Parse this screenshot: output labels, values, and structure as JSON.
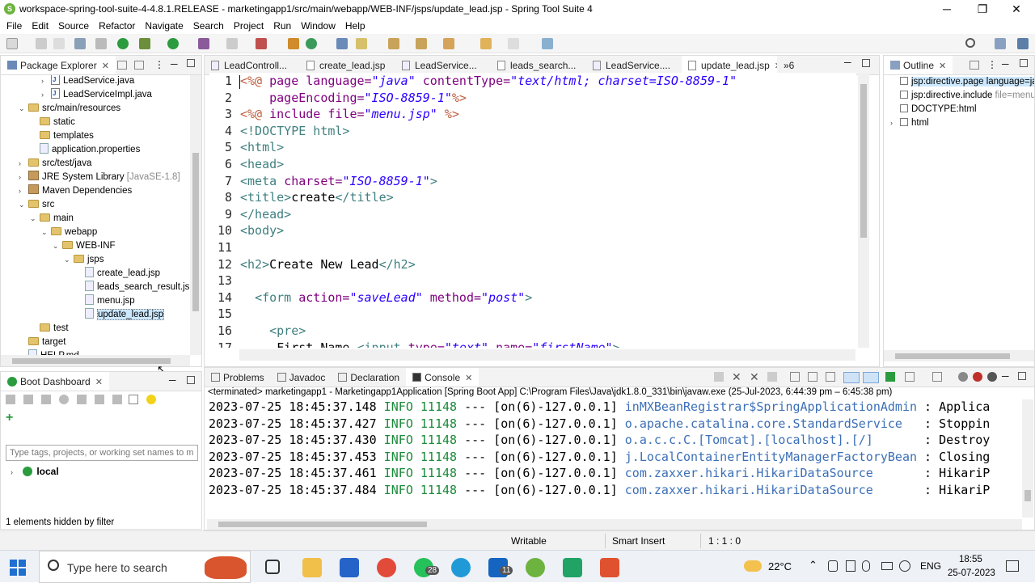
{
  "window": {
    "title": "workspace-spring-tool-suite-4-4.8.1.RELEASE - marketingapp1/src/main/webapp/WEB-INF/jsps/update_lead.jsp - Spring Tool Suite 4",
    "minimize": "─",
    "restore": "❐",
    "close": "✕"
  },
  "menu": [
    "File",
    "Edit",
    "Source",
    "Refactor",
    "Navigate",
    "Search",
    "Project",
    "Run",
    "Window",
    "Help"
  ],
  "package_explorer": {
    "tab_label": "Package Explorer",
    "items": [
      {
        "label": "LeadService.java",
        "extra": "",
        "kind": "java",
        "depth": 4,
        "twisty": "›"
      },
      {
        "label": "LeadServiceImpl.java",
        "extra": "",
        "kind": "java",
        "depth": 4,
        "twisty": "›"
      },
      {
        "label": "src/main/resources",
        "extra": "",
        "kind": "folder",
        "depth": 2,
        "twisty": "⌄"
      },
      {
        "label": "static",
        "extra": "",
        "kind": "folder",
        "depth": 3,
        "twisty": ""
      },
      {
        "label": "templates",
        "extra": "",
        "kind": "folder",
        "depth": 3,
        "twisty": ""
      },
      {
        "label": "application.properties",
        "extra": "",
        "kind": "props",
        "depth": 3,
        "twisty": ""
      },
      {
        "label": "src/test/java",
        "extra": "",
        "kind": "folder",
        "depth": 2,
        "twisty": "›"
      },
      {
        "label": "JRE System Library",
        "extra": " [JavaSE-1.8]",
        "kind": "jar",
        "depth": 2,
        "twisty": "›"
      },
      {
        "label": "Maven Dependencies",
        "extra": "",
        "kind": "jar",
        "depth": 2,
        "twisty": "›"
      },
      {
        "label": "src",
        "extra": "",
        "kind": "folder",
        "depth": 2,
        "twisty": "⌄"
      },
      {
        "label": "main",
        "extra": "",
        "kind": "folder",
        "depth": 3,
        "twisty": "⌄"
      },
      {
        "label": "webapp",
        "extra": "",
        "kind": "folder",
        "depth": 4,
        "twisty": "⌄"
      },
      {
        "label": "WEB-INF",
        "extra": "",
        "kind": "folder",
        "depth": 5,
        "twisty": "⌄"
      },
      {
        "label": "jsps",
        "extra": "",
        "kind": "folder",
        "depth": 6,
        "twisty": "⌄"
      },
      {
        "label": "create_lead.jsp",
        "extra": "",
        "kind": "file",
        "depth": 7,
        "twisty": ""
      },
      {
        "label": "leads_search_result.js",
        "extra": "",
        "kind": "file",
        "depth": 7,
        "twisty": ""
      },
      {
        "label": "menu.jsp",
        "extra": "",
        "kind": "file",
        "depth": 7,
        "twisty": ""
      },
      {
        "label": "update_lead.jsp",
        "extra": "",
        "kind": "file",
        "depth": 7,
        "twisty": "",
        "selected": true
      },
      {
        "label": "test",
        "extra": "",
        "kind": "folder",
        "depth": 3,
        "twisty": ""
      },
      {
        "label": "target",
        "extra": "",
        "kind": "folder",
        "depth": 2,
        "twisty": ""
      },
      {
        "label": "HELP.md",
        "extra": "",
        "kind": "file",
        "depth": 2,
        "twisty": ""
      }
    ]
  },
  "editor": {
    "tabs": [
      {
        "label": "LeadControll...",
        "active": false
      },
      {
        "label": "create_lead.jsp",
        "active": false
      },
      {
        "label": "LeadService...",
        "active": false
      },
      {
        "label": "leads_search...",
        "active": false
      },
      {
        "label": "LeadService....",
        "active": false
      },
      {
        "label": "update_lead.jsp",
        "active": true
      }
    ],
    "overflow": "»6",
    "lines": [
      {
        "n": "1",
        "parts": [
          [
            "jsp",
            "<%@ "
          ],
          [
            "attr",
            "page language="
          ],
          [
            "val",
            "\"java\""
          ],
          [
            "attr",
            " contentType="
          ],
          [
            "val",
            "\"text/html; charset=ISO-8859-1\""
          ]
        ]
      },
      {
        "n": "2",
        "parts": [
          [
            "txt",
            "    "
          ],
          [
            "attr",
            "pageEncoding="
          ],
          [
            "val",
            "\"ISO-8859-1\""
          ],
          [
            "jsp",
            "%>"
          ]
        ]
      },
      {
        "n": "3",
        "parts": [
          [
            "jsp",
            "<%@ "
          ],
          [
            "attr",
            "include file="
          ],
          [
            "val",
            "\"menu.jsp\""
          ],
          [
            "jsp",
            " %>"
          ]
        ]
      },
      {
        "n": "4",
        "parts": [
          [
            "tag",
            "<!DOCTYPE html>"
          ]
        ]
      },
      {
        "n": "5",
        "parts": [
          [
            "tag",
            "<html>"
          ]
        ]
      },
      {
        "n": "6",
        "parts": [
          [
            "tag",
            "<head>"
          ]
        ]
      },
      {
        "n": "7",
        "parts": [
          [
            "tag",
            "<meta "
          ],
          [
            "attr",
            "charset="
          ],
          [
            "val",
            "\"ISO-8859-1\""
          ],
          [
            "tag",
            ">"
          ]
        ]
      },
      {
        "n": "8",
        "parts": [
          [
            "tag",
            "<title>"
          ],
          [
            "txt",
            "create"
          ],
          [
            "tag",
            "</title>"
          ]
        ]
      },
      {
        "n": "9",
        "parts": [
          [
            "tag",
            "</head>"
          ]
        ]
      },
      {
        "n": "10",
        "parts": [
          [
            "tag",
            "<body>"
          ]
        ]
      },
      {
        "n": "11",
        "parts": []
      },
      {
        "n": "12",
        "parts": [
          [
            "tag",
            "<h2>"
          ],
          [
            "txt",
            "Create New Lead"
          ],
          [
            "tag",
            "</h2>"
          ]
        ]
      },
      {
        "n": "13",
        "parts": []
      },
      {
        "n": "14",
        "parts": [
          [
            "txt",
            "  "
          ],
          [
            "tag",
            "<form "
          ],
          [
            "attr",
            "action="
          ],
          [
            "val",
            "\"saveLead\""
          ],
          [
            "attr",
            " method="
          ],
          [
            "val",
            "\"post\""
          ],
          [
            "tag",
            ">"
          ]
        ]
      },
      {
        "n": "15",
        "parts": []
      },
      {
        "n": "16",
        "parts": [
          [
            "txt",
            "    "
          ],
          [
            "tag",
            "<pre>"
          ]
        ]
      },
      {
        "n": "17",
        "parts": [
          [
            "txt",
            "     First Name "
          ],
          [
            "tag",
            "<input "
          ],
          [
            "attr",
            "type="
          ],
          [
            "val",
            "\"text\""
          ],
          [
            "attr",
            " name="
          ],
          [
            "val",
            "\"firstName\""
          ],
          [
            "tag",
            ">"
          ]
        ]
      }
    ]
  },
  "outline": {
    "tab_label": "Outline",
    "items": [
      {
        "label": "jsp:directive.page language=ja",
        "extra": "",
        "twisty": "",
        "selected": true
      },
      {
        "label": "jsp:directive.include",
        "extra": " file=menu",
        "twisty": ""
      },
      {
        "label": "DOCTYPE:html",
        "extra": "",
        "twisty": ""
      },
      {
        "label": "html",
        "extra": "",
        "twisty": "›"
      }
    ]
  },
  "boot_dashboard": {
    "tab_label": "Boot Dashboard",
    "filter_placeholder": "Type tags, projects, or working set names to m",
    "local_label": "local",
    "hidden_note": "1 elements hidden by filter"
  },
  "console": {
    "tabs": [
      {
        "label": "Problems",
        "active": false
      },
      {
        "label": "Javadoc",
        "active": false
      },
      {
        "label": "Declaration",
        "active": false
      },
      {
        "label": "Console",
        "active": true
      }
    ],
    "header": "<terminated> marketingapp1 - Marketingapp1Application [Spring Boot App] C:\\Program Files\\Java\\jdk1.8.0_331\\bin\\javaw.exe  (25-Jul-2023, 6:44:39 pm – 6:45:38 pm)",
    "lines": [
      {
        "ts": "2023-07-25 18:45:37.148",
        "level": "INFO",
        "pid": "11148",
        "thread": "--- [on(6)-127.0.0.1]",
        "logger": "inMXBeanRegistrar$SpringApplicationAdmin",
        "msg": ": Applica"
      },
      {
        "ts": "2023-07-25 18:45:37.427",
        "level": "INFO",
        "pid": "11148",
        "thread": "--- [on(6)-127.0.0.1]",
        "logger": "o.apache.catalina.core.StandardService  ",
        "msg": ": Stoppin"
      },
      {
        "ts": "2023-07-25 18:45:37.430",
        "level": "INFO",
        "pid": "11148",
        "thread": "--- [on(6)-127.0.0.1]",
        "logger": "o.a.c.c.C.[Tomcat].[localhost].[/]      ",
        "msg": ": Destroy"
      },
      {
        "ts": "2023-07-25 18:45:37.453",
        "level": "INFO",
        "pid": "11148",
        "thread": "--- [on(6)-127.0.0.1]",
        "logger": "j.LocalContainerEntityManagerFactoryBean",
        "msg": ": Closing"
      },
      {
        "ts": "2023-07-25 18:45:37.461",
        "level": "INFO",
        "pid": "11148",
        "thread": "--- [on(6)-127.0.0.1]",
        "logger": "com.zaxxer.hikari.HikariDataSource      ",
        "msg": ": HikariP"
      },
      {
        "ts": "2023-07-25 18:45:37.484",
        "level": "INFO",
        "pid": "11148",
        "thread": "--- [on(6)-127.0.0.1]",
        "logger": "com.zaxxer.hikari.HikariDataSource      ",
        "msg": ": HikariP"
      }
    ]
  },
  "status": {
    "writable": "Writable",
    "insert_mode": "Smart Insert",
    "position": "1 : 1 : 0"
  },
  "taskbar": {
    "search_placeholder": "Type here to search",
    "whatsapp_badge": "28",
    "mail_badge": "11",
    "temperature": "22°C",
    "language": "ENG",
    "time": "18:55",
    "date": "25-07-2023"
  }
}
